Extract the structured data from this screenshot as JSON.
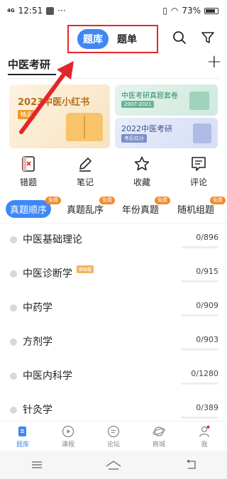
{
  "status_bar": {
    "time": "12:51",
    "signal": "4G",
    "dots": "···",
    "battery": "73%"
  },
  "top_tabs": [
    {
      "label": "题库"
    },
    {
      "label": "题单"
    }
  ],
  "section": {
    "title": "中医考研"
  },
  "banners": {
    "left": {
      "title": "2023中医小红书",
      "tag": "精品"
    },
    "right_top": {
      "title": "中医考研真题套卷",
      "tag": "2007-2021"
    },
    "right_bottom": {
      "title": "2022中医考研",
      "tag": "考后估分"
    }
  },
  "quick": [
    {
      "label": "错题"
    },
    {
      "label": "笔记"
    },
    {
      "label": "收藏"
    },
    {
      "label": "评论"
    }
  ],
  "mode_tabs": [
    {
      "label": "真题顺序",
      "badge": "免费"
    },
    {
      "label": "真题乱序",
      "badge": "免费"
    },
    {
      "label": "年份真题",
      "badge": "免费"
    },
    {
      "label": "随机组题",
      "badge": "免费"
    }
  ],
  "subjects": [
    {
      "name": "中医基础理论",
      "progress": "0/896"
    },
    {
      "name": "中医诊断学",
      "progress": "0/915",
      "tag": "继续做"
    },
    {
      "name": "中药学",
      "progress": "0/909"
    },
    {
      "name": "方剂学",
      "progress": "0/903"
    },
    {
      "name": "中医内科学",
      "progress": "0/1280"
    },
    {
      "name": "针灸学",
      "progress": "0/389"
    }
  ],
  "bottom_nav": [
    {
      "label": "题库"
    },
    {
      "label": "课程"
    },
    {
      "label": "论坛"
    },
    {
      "label": "商城"
    },
    {
      "label": "我"
    }
  ],
  "colors": {
    "accent": "#3f87f5",
    "highlight_box": "#e3262b",
    "badge": "#f28a2a"
  }
}
